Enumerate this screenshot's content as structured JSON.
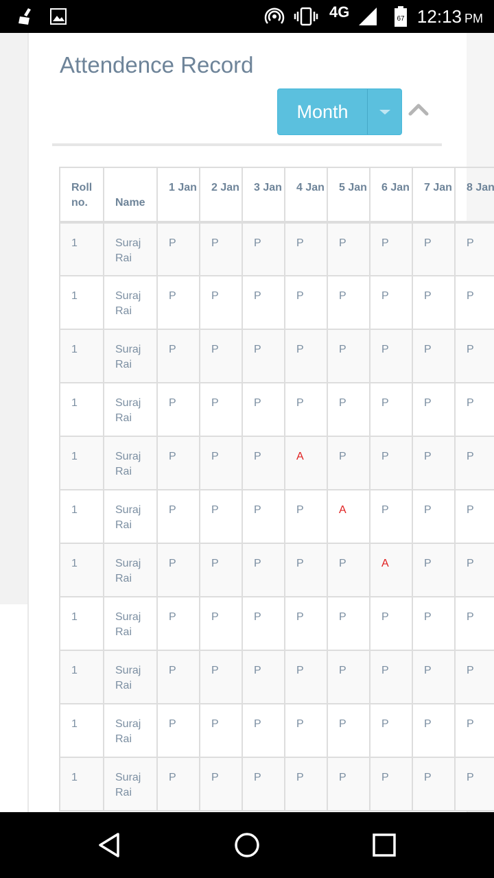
{
  "status_bar": {
    "time": "12:13",
    "ampm": "PM",
    "network": "4G",
    "battery": "67",
    "icons": [
      "cleaner-icon",
      "image-icon",
      "hotspot-icon",
      "vibrate-icon",
      "signal-icon",
      "battery-icon"
    ]
  },
  "page": {
    "title": "Attendence Record",
    "month_button": "Month"
  },
  "table": {
    "headers": {
      "roll": "Roll no.",
      "name": "Name",
      "d1": "1 Jan",
      "d2": "2 Jan",
      "d3": "3 Jan",
      "d4": "4 Jan",
      "d5": "5 Jan",
      "d6": "6 Jan",
      "d7": "7 Jan",
      "d8": "8 Jan"
    },
    "rows": [
      {
        "roll": "1",
        "name": "Suraj Rai",
        "d": [
          "P",
          "P",
          "P",
          "P",
          "P",
          "P",
          "P",
          "P"
        ]
      },
      {
        "roll": "1",
        "name": "Suraj Rai",
        "d": [
          "P",
          "P",
          "P",
          "P",
          "P",
          "P",
          "P",
          "P"
        ]
      },
      {
        "roll": "1",
        "name": "Suraj Rai",
        "d": [
          "P",
          "P",
          "P",
          "P",
          "P",
          "P",
          "P",
          "P"
        ]
      },
      {
        "roll": "1",
        "name": "Suraj Rai",
        "d": [
          "P",
          "P",
          "P",
          "P",
          "P",
          "P",
          "P",
          "P"
        ]
      },
      {
        "roll": "1",
        "name": "Suraj Rai",
        "d": [
          "P",
          "P",
          "P",
          "A",
          "P",
          "P",
          "P",
          "P"
        ]
      },
      {
        "roll": "1",
        "name": "Suraj Rai",
        "d": [
          "P",
          "P",
          "P",
          "P",
          "A",
          "P",
          "P",
          "P"
        ]
      },
      {
        "roll": "1",
        "name": "Suraj Rai",
        "d": [
          "P",
          "P",
          "P",
          "P",
          "P",
          "A",
          "P",
          "P"
        ]
      },
      {
        "roll": "1",
        "name": "Suraj Rai",
        "d": [
          "P",
          "P",
          "P",
          "P",
          "P",
          "P",
          "P",
          "P"
        ]
      },
      {
        "roll": "1",
        "name": "Suraj Rai",
        "d": [
          "P",
          "P",
          "P",
          "P",
          "P",
          "P",
          "P",
          "P"
        ]
      },
      {
        "roll": "1",
        "name": "Suraj Rai",
        "d": [
          "P",
          "P",
          "P",
          "P",
          "P",
          "P",
          "P",
          "P"
        ]
      },
      {
        "roll": "1",
        "name": "Suraj Rai",
        "d": [
          "P",
          "P",
          "P",
          "P",
          "P",
          "P",
          "P",
          "P"
        ]
      }
    ]
  },
  "colors": {
    "accent": "#5bc0de",
    "title": "#6e8499",
    "absent": "#e01f1f"
  },
  "nav_bar": {
    "icons": [
      "back-icon",
      "home-icon",
      "recents-icon"
    ]
  }
}
